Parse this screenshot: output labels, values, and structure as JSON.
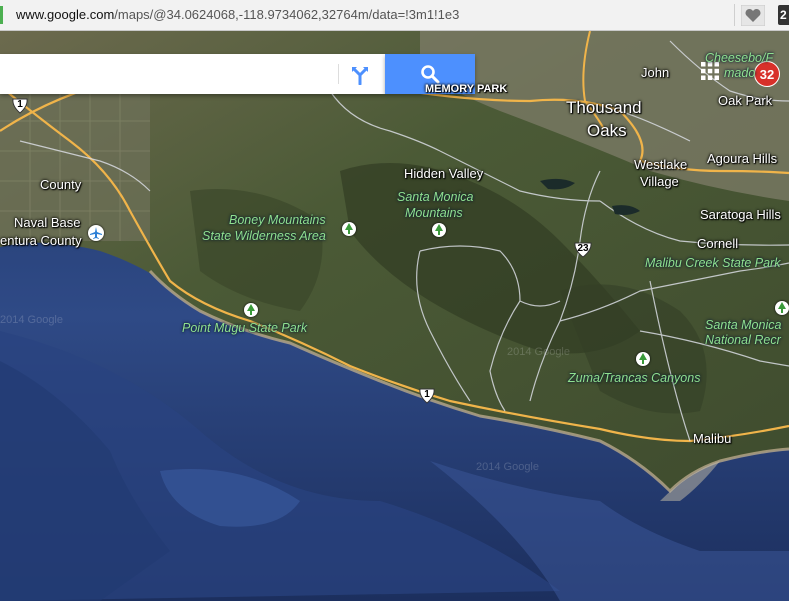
{
  "browser": {
    "url_host": "www.google.com",
    "url_rest": "/maps/@34.0624068,-118.9734062,32764m/data=!3m1!1e3",
    "extension_badge": "2"
  },
  "search": {
    "placeholder": ""
  },
  "notifications": {
    "count": "32"
  },
  "labels": {
    "thousand": "Thousand",
    "oaks": "Oaks",
    "john": "John",
    "oak_park": "Oak Park",
    "cheeseboro": "Cheesebo/F",
    "cheeseboro2": "mado",
    "hidden_valley": "Hidden Valley",
    "westlake": "Westlake",
    "village": "Village",
    "agoura_hills": "Agoura Hills",
    "saratoga_hills": "Saratoga Hills",
    "cornell": "Cornell",
    "county": "County",
    "naval_base": "Naval Base",
    "ventura_county": "entura County",
    "malibu": "Malibu",
    "memory_park": "MEMORY PARK",
    "santa_monica_mountains_1": "Santa Monica",
    "santa_monica_mountains_2": "Mountains",
    "boney_1": "Boney Mountains",
    "boney_2": "State Wilderness Area",
    "point_mugu": "Point Mugu State Park",
    "malibu_creek": "Malibu Creek State Park",
    "santa_monica_nra_1": "Santa Monica",
    "santa_monica_nra_2": "National Recr",
    "zuma": "Zuma/Trancas Canyons",
    "watermark_1": "2014 Google",
    "watermark_2": "2014 Google",
    "watermark_3": "2014 Google"
  },
  "routes": {
    "hwy1_a": "1",
    "hwy1_b": "1",
    "hwy23": "23"
  },
  "icons": {
    "directions": "directions-icon",
    "search": "search-icon",
    "favorite": "heart-icon",
    "apps": "apps-grid-icon",
    "park": "tree-icon",
    "airport": "airplane-icon"
  },
  "colors": {
    "search_button": "#4d90fe",
    "ocean": "#233a6e",
    "land": "#4b5a36",
    "park_label": "#8fe08f",
    "highway": "#f0b44a",
    "notification": "#d8302a"
  }
}
